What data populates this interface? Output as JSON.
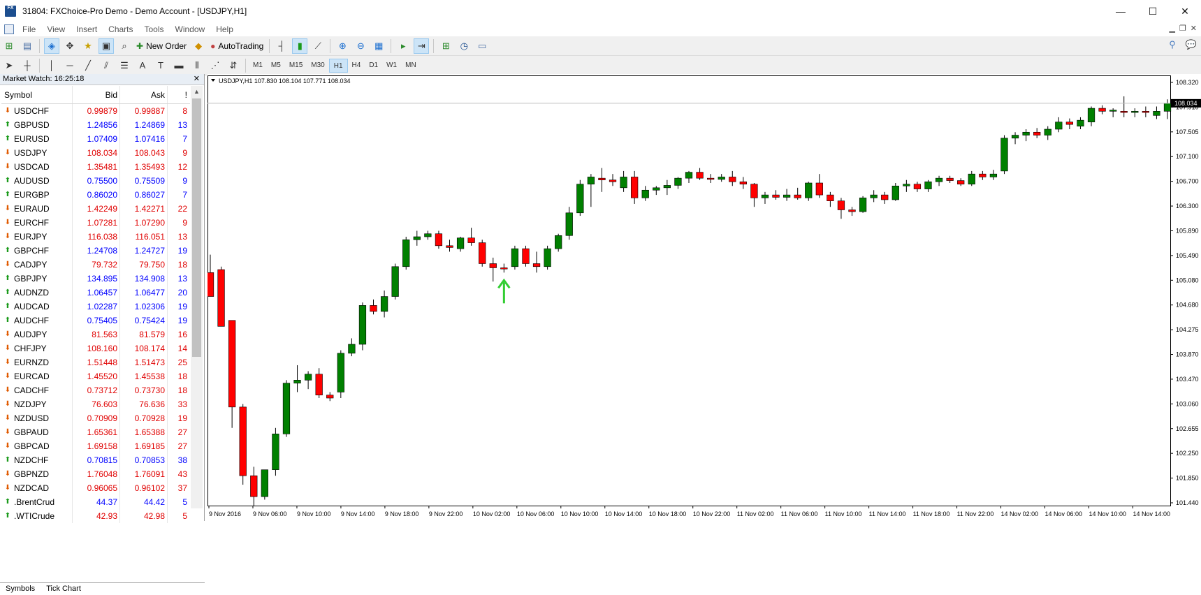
{
  "window": {
    "app_icon": "FX",
    "title": "31804: FXChoice-Pro Demo - Demo Account - [USDJPY,H1]",
    "minimize": "—",
    "maximize": "☐",
    "close": "✕"
  },
  "menu": {
    "items": [
      "File",
      "View",
      "Insert",
      "Charts",
      "Tools",
      "Window",
      "Help"
    ]
  },
  "toolbar": {
    "new_order": "New Order",
    "auto_trading": "AutoTrading",
    "timeframes": [
      "M1",
      "M5",
      "M15",
      "M30",
      "H1",
      "H4",
      "D1",
      "W1",
      "MN"
    ],
    "selected_timeframe": "H1"
  },
  "market_watch": {
    "title": "Market Watch: 16:25:18",
    "close": "✕",
    "headers": {
      "symbol": "Symbol",
      "bid": "Bid",
      "ask": "Ask",
      "spread": "!"
    },
    "rows": [
      {
        "symbol": "USDCHF",
        "bid": "0.99879",
        "ask": "0.99887",
        "spread": "8",
        "dir": "dn",
        "color": "red"
      },
      {
        "symbol": "GBPUSD",
        "bid": "1.24856",
        "ask": "1.24869",
        "spread": "13",
        "dir": "up",
        "color": "blue"
      },
      {
        "symbol": "EURUSD",
        "bid": "1.07409",
        "ask": "1.07416",
        "spread": "7",
        "dir": "up",
        "color": "blue"
      },
      {
        "symbol": "USDJPY",
        "bid": "108.034",
        "ask": "108.043",
        "spread": "9",
        "dir": "dn",
        "color": "red"
      },
      {
        "symbol": "USDCAD",
        "bid": "1.35481",
        "ask": "1.35493",
        "spread": "12",
        "dir": "dn",
        "color": "red"
      },
      {
        "symbol": "AUDUSD",
        "bid": "0.75500",
        "ask": "0.75509",
        "spread": "9",
        "dir": "up",
        "color": "blue"
      },
      {
        "symbol": "EURGBP",
        "bid": "0.86020",
        "ask": "0.86027",
        "spread": "7",
        "dir": "up",
        "color": "blue"
      },
      {
        "symbol": "EURAUD",
        "bid": "1.42249",
        "ask": "1.42271",
        "spread": "22",
        "dir": "dn",
        "color": "red"
      },
      {
        "symbol": "EURCHF",
        "bid": "1.07281",
        "ask": "1.07290",
        "spread": "9",
        "dir": "dn",
        "color": "red"
      },
      {
        "symbol": "EURJPY",
        "bid": "116.038",
        "ask": "116.051",
        "spread": "13",
        "dir": "dn",
        "color": "red"
      },
      {
        "symbol": "GBPCHF",
        "bid": "1.24708",
        "ask": "1.24727",
        "spread": "19",
        "dir": "up",
        "color": "blue"
      },
      {
        "symbol": "CADJPY",
        "bid": "79.732",
        "ask": "79.750",
        "spread": "18",
        "dir": "dn",
        "color": "red"
      },
      {
        "symbol": "GBPJPY",
        "bid": "134.895",
        "ask": "134.908",
        "spread": "13",
        "dir": "up",
        "color": "blue"
      },
      {
        "symbol": "AUDNZD",
        "bid": "1.06457",
        "ask": "1.06477",
        "spread": "20",
        "dir": "up",
        "color": "blue"
      },
      {
        "symbol": "AUDCAD",
        "bid": "1.02287",
        "ask": "1.02306",
        "spread": "19",
        "dir": "up",
        "color": "blue"
      },
      {
        "symbol": "AUDCHF",
        "bid": "0.75405",
        "ask": "0.75424",
        "spread": "19",
        "dir": "up",
        "color": "blue"
      },
      {
        "symbol": "AUDJPY",
        "bid": "81.563",
        "ask": "81.579",
        "spread": "16",
        "dir": "dn",
        "color": "red"
      },
      {
        "symbol": "CHFJPY",
        "bid": "108.160",
        "ask": "108.174",
        "spread": "14",
        "dir": "dn",
        "color": "red"
      },
      {
        "symbol": "EURNZD",
        "bid": "1.51448",
        "ask": "1.51473",
        "spread": "25",
        "dir": "dn",
        "color": "red"
      },
      {
        "symbol": "EURCAD",
        "bid": "1.45520",
        "ask": "1.45538",
        "spread": "18",
        "dir": "dn",
        "color": "red"
      },
      {
        "symbol": "CADCHF",
        "bid": "0.73712",
        "ask": "0.73730",
        "spread": "18",
        "dir": "dn",
        "color": "red"
      },
      {
        "symbol": "NZDJPY",
        "bid": "76.603",
        "ask": "76.636",
        "spread": "33",
        "dir": "dn",
        "color": "red"
      },
      {
        "symbol": "NZDUSD",
        "bid": "0.70909",
        "ask": "0.70928",
        "spread": "19",
        "dir": "dn",
        "color": "red"
      },
      {
        "symbol": "GBPAUD",
        "bid": "1.65361",
        "ask": "1.65388",
        "spread": "27",
        "dir": "dn",
        "color": "red"
      },
      {
        "symbol": "GBPCAD",
        "bid": "1.69158",
        "ask": "1.69185",
        "spread": "27",
        "dir": "dn",
        "color": "red"
      },
      {
        "symbol": "NZDCHF",
        "bid": "0.70815",
        "ask": "0.70853",
        "spread": "38",
        "dir": "up",
        "color": "blue"
      },
      {
        "symbol": "GBPNZD",
        "bid": "1.76048",
        "ask": "1.76091",
        "spread": "43",
        "dir": "dn",
        "color": "red"
      },
      {
        "symbol": "NZDCAD",
        "bid": "0.96065",
        "ask": "0.96102",
        "spread": "37",
        "dir": "dn",
        "color": "red"
      },
      {
        "symbol": ".BrentCrud",
        "bid": "44.37",
        "ask": "44.42",
        "spread": "5",
        "dir": "up",
        "color": "blue"
      },
      {
        "symbol": ".WTICrude",
        "bid": "42.93",
        "ask": "42.98",
        "spread": "5",
        "dir": "up",
        "color": "red"
      }
    ],
    "tabs": [
      "Symbols",
      "Tick Chart"
    ]
  },
  "chart_data": {
    "type": "candlestick",
    "header": "USDJPY,H1  107.830 108.104 107.771 108.034",
    "symbol": "USDJPY",
    "timeframe": "H1",
    "current_price": "108.034",
    "y_ticks": [
      "108.320",
      "107.910",
      "107.505",
      "107.100",
      "106.700",
      "106.300",
      "105.890",
      "105.490",
      "105.080",
      "104.680",
      "104.275",
      "103.870",
      "103.470",
      "103.060",
      "102.655",
      "102.250",
      "101.850",
      "101.440"
    ],
    "x_ticks": [
      "9 Nov 2016",
      "9 Nov 06:00",
      "9 Nov 10:00",
      "9 Nov 14:00",
      "9 Nov 18:00",
      "9 Nov 22:00",
      "10 Nov 02:00",
      "10 Nov 06:00",
      "10 Nov 10:00",
      "10 Nov 14:00",
      "10 Nov 18:00",
      "10 Nov 22:00",
      "11 Nov 02:00",
      "11 Nov 06:00",
      "11 Nov 10:00",
      "11 Nov 14:00",
      "11 Nov 18:00",
      "11 Nov 22:00",
      "14 Nov 02:00",
      "14 Nov 06:00",
      "14 Nov 10:00",
      "14 Nov 14:00"
    ],
    "ylim": [
      101.3,
      108.5
    ],
    "bull_color": "#008000",
    "bear_color": "#ff0000",
    "arrow_color": "#32cd32",
    "candles": [
      [
        105.2,
        105.5,
        104.8,
        104.8
      ],
      [
        105.25,
        105.3,
        104.3,
        104.3
      ],
      [
        104.4,
        104.4,
        102.6,
        102.95
      ],
      [
        102.95,
        103.0,
        101.65,
        101.8
      ],
      [
        101.8,
        101.95,
        101.3,
        101.45
      ],
      [
        101.45,
        101.85,
        101.4,
        101.9
      ],
      [
        101.9,
        102.6,
        101.8,
        102.5
      ],
      [
        102.5,
        103.4,
        102.45,
        103.35
      ],
      [
        103.35,
        103.65,
        103.2,
        103.4
      ],
      [
        103.4,
        103.55,
        103.25,
        103.5
      ],
      [
        103.5,
        103.6,
        103.1,
        103.15
      ],
      [
        103.15,
        103.2,
        103.05,
        103.1
      ],
      [
        103.2,
        103.9,
        103.1,
        103.85
      ],
      [
        103.85,
        104.1,
        103.8,
        104.0
      ],
      [
        104.0,
        104.7,
        103.9,
        104.65
      ],
      [
        104.65,
        104.75,
        104.5,
        104.55
      ],
      [
        104.55,
        104.9,
        104.45,
        104.8
      ],
      [
        104.8,
        105.35,
        104.75,
        105.3
      ],
      [
        105.3,
        105.8,
        105.25,
        105.75
      ],
      [
        105.75,
        105.9,
        105.65,
        105.8
      ],
      [
        105.8,
        105.9,
        105.75,
        105.85
      ],
      [
        105.85,
        105.9,
        105.6,
        105.65
      ],
      [
        105.65,
        105.75,
        105.55,
        105.62
      ],
      [
        105.6,
        105.8,
        105.55,
        105.78
      ],
      [
        105.78,
        105.95,
        105.65,
        105.7
      ],
      [
        105.7,
        105.75,
        105.3,
        105.35
      ],
      [
        105.35,
        105.45,
        105.05,
        105.28
      ],
      [
        105.28,
        105.35,
        105.2,
        105.26
      ],
      [
        105.3,
        105.65,
        105.25,
        105.6
      ],
      [
        105.6,
        105.65,
        105.3,
        105.35
      ],
      [
        105.35,
        105.55,
        105.2,
        105.3
      ],
      [
        105.3,
        105.65,
        105.25,
        105.6
      ],
      [
        105.6,
        105.85,
        105.55,
        105.82
      ],
      [
        105.82,
        106.3,
        105.75,
        106.2
      ],
      [
        106.2,
        106.75,
        106.15,
        106.68
      ],
      [
        106.68,
        106.85,
        106.3,
        106.8
      ],
      [
        106.78,
        106.95,
        106.55,
        106.75
      ],
      [
        106.75,
        106.85,
        106.65,
        106.72
      ],
      [
        106.62,
        106.9,
        106.55,
        106.8
      ],
      [
        106.8,
        106.9,
        106.35,
        106.45
      ],
      [
        106.45,
        106.65,
        106.4,
        106.58
      ],
      [
        106.58,
        106.65,
        106.5,
        106.62
      ],
      [
        106.62,
        106.75,
        106.5,
        106.66
      ],
      [
        106.66,
        106.8,
        106.6,
        106.78
      ],
      [
        106.78,
        106.9,
        106.7,
        106.88
      ],
      [
        106.88,
        106.95,
        106.75,
        106.78
      ],
      [
        106.78,
        106.85,
        106.7,
        106.76
      ],
      [
        106.76,
        106.85,
        106.72,
        106.8
      ],
      [
        106.8,
        106.9,
        106.65,
        106.72
      ],
      [
        106.72,
        106.8,
        106.6,
        106.68
      ],
      [
        106.68,
        106.7,
        106.3,
        106.45
      ],
      [
        106.45,
        106.55,
        106.35,
        106.5
      ],
      [
        106.5,
        106.58,
        106.42,
        106.46
      ],
      [
        106.46,
        106.6,
        106.4,
        106.5
      ],
      [
        106.5,
        106.62,
        106.42,
        106.45
      ],
      [
        106.45,
        106.72,
        106.4,
        106.7
      ],
      [
        106.7,
        106.85,
        106.45,
        106.5
      ],
      [
        106.5,
        106.55,
        106.3,
        106.4
      ],
      [
        106.4,
        106.45,
        106.1,
        106.25
      ],
      [
        106.25,
        106.3,
        106.15,
        106.22
      ],
      [
        106.22,
        106.48,
        106.2,
        106.45
      ],
      [
        106.45,
        106.58,
        106.38,
        106.5
      ],
      [
        106.5,
        106.55,
        106.35,
        106.42
      ],
      [
        106.42,
        106.7,
        106.4,
        106.65
      ],
      [
        106.65,
        106.75,
        106.55,
        106.68
      ],
      [
        106.68,
        106.72,
        106.55,
        106.6
      ],
      [
        106.6,
        106.75,
        106.55,
        106.72
      ],
      [
        106.72,
        106.82,
        106.65,
        106.78
      ],
      [
        106.78,
        106.82,
        106.7,
        106.74
      ],
      [
        106.74,
        106.78,
        106.65,
        106.68
      ],
      [
        106.68,
        106.9,
        106.65,
        106.85
      ],
      [
        106.85,
        106.9,
        106.75,
        106.8
      ],
      [
        106.8,
        106.92,
        106.75,
        106.85
      ],
      [
        106.9,
        107.5,
        106.85,
        107.45
      ],
      [
        107.45,
        107.55,
        107.35,
        107.5
      ],
      [
        107.5,
        107.6,
        107.4,
        107.55
      ],
      [
        107.55,
        107.62,
        107.45,
        107.5
      ],
      [
        107.5,
        107.65,
        107.42,
        107.6
      ],
      [
        107.6,
        107.8,
        107.55,
        107.72
      ],
      [
        107.72,
        107.78,
        107.6,
        107.68
      ],
      [
        107.65,
        107.8,
        107.6,
        107.75
      ],
      [
        107.72,
        107.98,
        107.65,
        107.95
      ],
      [
        107.95,
        108.0,
        107.85,
        107.9
      ],
      [
        107.9,
        107.95,
        107.8,
        107.92
      ],
      [
        107.9,
        108.15,
        107.8,
        107.88
      ],
      [
        107.88,
        107.95,
        107.8,
        107.9
      ],
      [
        107.9,
        107.98,
        107.8,
        107.88
      ],
      [
        107.83,
        107.98,
        107.77,
        107.9
      ],
      [
        107.9,
        108.1,
        107.77,
        108.034
      ]
    ],
    "arrow_candle_index": 27
  }
}
